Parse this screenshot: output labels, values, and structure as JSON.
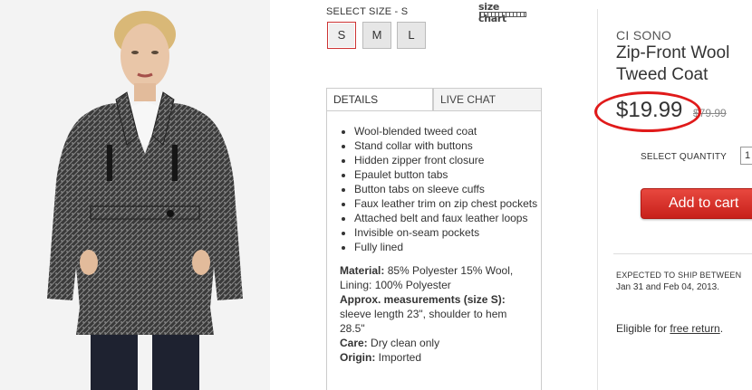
{
  "size_selector": {
    "label": "SELECT SIZE - ",
    "selected": "S",
    "sizes": [
      "S",
      "M",
      "L"
    ],
    "chart_link": "size chart"
  },
  "tabs": {
    "details": "DETAILS",
    "chat": "LIVE CHAT"
  },
  "details": {
    "features": [
      "Wool-blended tweed coat",
      "Stand collar with buttons",
      "Hidden zipper front closure",
      "Epaulet button tabs",
      "Button tabs on sleeve cuffs",
      "Faux leather trim on zip chest pockets",
      "Attached belt and faux leather loops",
      "Invisible on-seam pockets",
      "Fully lined"
    ],
    "material_label": "Material:",
    "material_value": "85% Polyester 15% Wool, Lining: 100% Polyester",
    "measure_label": "Approx. measurements (size S):",
    "measure_value": "sleeve length 23\", shoulder to hem 28.5\"",
    "care_label": "Care:",
    "care_value": "Dry clean only",
    "origin_label": "Origin:",
    "origin_value": "Imported"
  },
  "product": {
    "brand": "CI SONO",
    "title_line1": "Zip-Front Wool",
    "title_line2": "Tweed Coat",
    "price": "$19.99",
    "old_price": "$79.99",
    "highlight_color": "#e01a1a"
  },
  "purchase": {
    "qty_label": "SELECT QUANTITY",
    "qty_value": "1",
    "add_to_cart": "Add to cart",
    "button_color": "#d52b22"
  },
  "shipping": {
    "label": "EXPECTED TO SHIP BETWEEN",
    "dates": "Jan 31 and Feb 04, 2013."
  },
  "returns": {
    "prefix": "Eligible for ",
    "link": "free return",
    "suffix": "."
  }
}
